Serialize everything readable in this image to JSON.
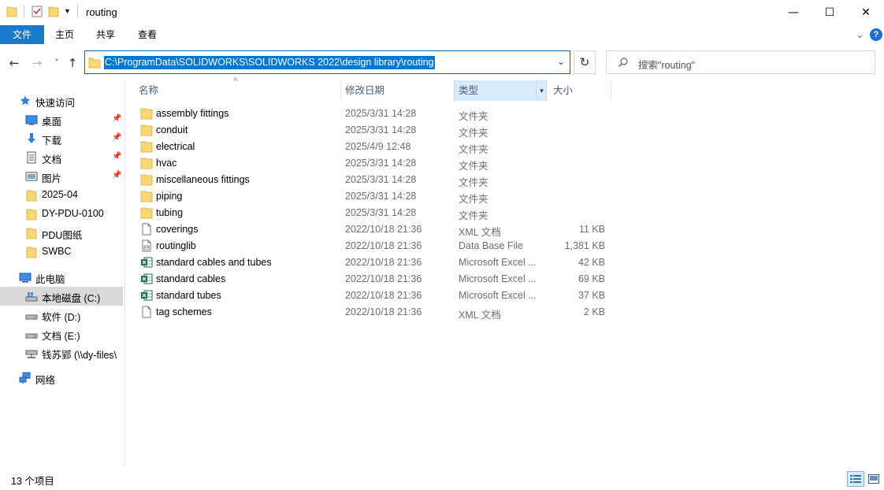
{
  "window": {
    "title": "routing",
    "minimize_glyph": "—",
    "maximize_glyph": "☐",
    "close_glyph": "✕"
  },
  "ribbon": {
    "tabs": [
      {
        "label": "文件"
      },
      {
        "label": "主页"
      },
      {
        "label": "共享"
      },
      {
        "label": "查看"
      }
    ],
    "accent_color": "#1979ca"
  },
  "navigation": {
    "back_glyph": "←",
    "forward_glyph": "→",
    "recent_glyph": "˅",
    "up_glyph": "↑",
    "address_path": "C:\\ProgramData\\SOLIDWORKS\\SOLIDWORKS 2022\\design library\\routing",
    "refresh_glyph": "↻",
    "search_placeholder": "搜索\"routing\""
  },
  "sidebar": {
    "quick_access": {
      "label": "快速访问",
      "icon": "star-icon"
    },
    "pinned": [
      {
        "label": "桌面",
        "icon": "desktop-icon"
      },
      {
        "label": "下载",
        "icon": "download-icon"
      },
      {
        "label": "文档",
        "icon": "documents-icon"
      },
      {
        "label": "图片",
        "icon": "pictures-icon"
      }
    ],
    "recent_folders": [
      {
        "label": "2025-04"
      },
      {
        "label": "DY-PDU-0100"
      },
      {
        "label": "PDU图纸"
      },
      {
        "label": "SWBC"
      }
    ],
    "this_pc": {
      "label": "此电脑",
      "icon": "computer-icon"
    },
    "drives": [
      {
        "label": "本地磁盘 (C:)",
        "icon": "windows-drive-icon"
      },
      {
        "label": "软件 (D:)",
        "icon": "drive-icon"
      },
      {
        "label": "文档 (E:)",
        "icon": "drive-icon"
      },
      {
        "label": "钱苏郢 (\\\\dy-files\\",
        "icon": "network-drive-icon"
      }
    ],
    "network": {
      "label": "网络",
      "icon": "network-icon"
    }
  },
  "columns": {
    "name": "名称",
    "date": "修改日期",
    "type": "类型",
    "size": "大小"
  },
  "files": [
    {
      "name": "assembly fittings",
      "date": "2025/3/31 14:28",
      "type": "文件夹",
      "size": "",
      "icon": "folder-icon"
    },
    {
      "name": "conduit",
      "date": "2025/3/31 14:28",
      "type": "文件夹",
      "size": "",
      "icon": "folder-icon"
    },
    {
      "name": "electrical",
      "date": "2025/4/9 12:48",
      "type": "文件夹",
      "size": "",
      "icon": "folder-icon"
    },
    {
      "name": "hvac",
      "date": "2025/3/31 14:28",
      "type": "文件夹",
      "size": "",
      "icon": "folder-icon"
    },
    {
      "name": "miscellaneous fittings",
      "date": "2025/3/31 14:28",
      "type": "文件夹",
      "size": "",
      "icon": "folder-icon"
    },
    {
      "name": "piping",
      "date": "2025/3/31 14:28",
      "type": "文件夹",
      "size": "",
      "icon": "folder-icon"
    },
    {
      "name": "tubing",
      "date": "2025/3/31 14:28",
      "type": "文件夹",
      "size": "",
      "icon": "folder-icon"
    },
    {
      "name": "coverings",
      "date": "2022/10/18 21:36",
      "type": "XML 文档",
      "size": "11 KB",
      "icon": "document-icon"
    },
    {
      "name": "routinglib",
      "date": "2022/10/18 21:36",
      "type": "Data Base File",
      "size": "1,381 KB",
      "icon": "database-file-icon"
    },
    {
      "name": "standard cables and tubes",
      "date": "2022/10/18 21:36",
      "type": "Microsoft Excel ...",
      "size": "42 KB",
      "icon": "excel-icon"
    },
    {
      "name": "standard cables",
      "date": "2022/10/18 21:36",
      "type": "Microsoft Excel ...",
      "size": "69 KB",
      "icon": "excel-icon"
    },
    {
      "name": "standard tubes",
      "date": "2022/10/18 21:36",
      "type": "Microsoft Excel ...",
      "size": "37 KB",
      "icon": "excel-icon"
    },
    {
      "name": "tag schemes",
      "date": "2022/10/18 21:36",
      "type": "XML 文档",
      "size": "2 KB",
      "icon": "document-icon"
    }
  ],
  "status": {
    "item_count": "13 个项目"
  },
  "colors": {
    "folder": "#f8d775",
    "selection": "#0078d7",
    "excel": "#1e7145"
  }
}
